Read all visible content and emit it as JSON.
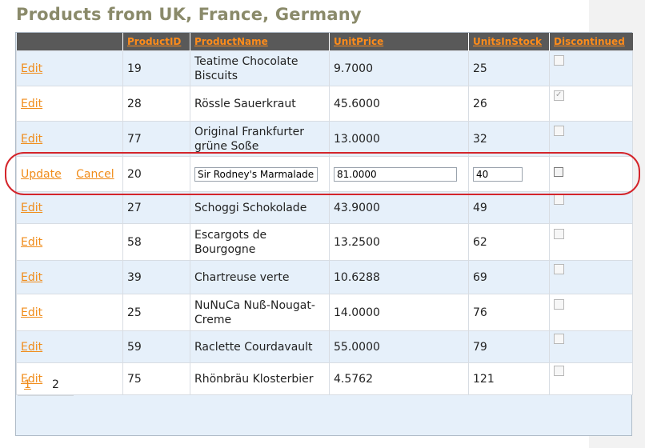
{
  "page_title": "Products from UK, France, Germany",
  "columns": [
    "",
    "ProductID",
    "ProductName",
    "UnitPrice",
    "UnitsInStock",
    "Discontinued"
  ],
  "commands": {
    "edit": "Edit",
    "update": "Update",
    "cancel": "Cancel"
  },
  "rows": [
    {
      "id": "19",
      "name": "Teatime Chocolate Biscuits",
      "price": "9.7000",
      "stock": "25",
      "discontinued": false
    },
    {
      "id": "28",
      "name": "Rössle Sauerkraut",
      "price": "45.6000",
      "stock": "26",
      "discontinued": true
    },
    {
      "id": "77",
      "name": "Original Frankfurter grüne Soße",
      "price": "13.0000",
      "stock": "32",
      "discontinued": false
    },
    {
      "id": "20",
      "name": "Sir Rodney's Marmalade",
      "price": "81.0000",
      "stock": "40",
      "discontinued": false,
      "editing": true
    },
    {
      "id": "27",
      "name": "Schoggi Schokolade",
      "price": "43.9000",
      "stock": "49",
      "discontinued": false
    },
    {
      "id": "58",
      "name": "Escargots de Bourgogne",
      "price": "13.2500",
      "stock": "62",
      "discontinued": false
    },
    {
      "id": "39",
      "name": "Chartreuse verte",
      "price": "10.6288",
      "stock": "69",
      "discontinued": false
    },
    {
      "id": "25",
      "name": "NuNuCa Nuß-Nougat-Creme",
      "price": "14.0000",
      "stock": "76",
      "discontinued": false
    },
    {
      "id": "59",
      "name": "Raclette Courdavault",
      "price": "55.0000",
      "stock": "79",
      "discontinued": false
    },
    {
      "id": "75",
      "name": "Rhönbräu Klosterbier",
      "price": "4.5762",
      "stock": "121",
      "discontinued": false
    }
  ],
  "pager": {
    "page1": "1",
    "page2": "2",
    "current": "2"
  }
}
